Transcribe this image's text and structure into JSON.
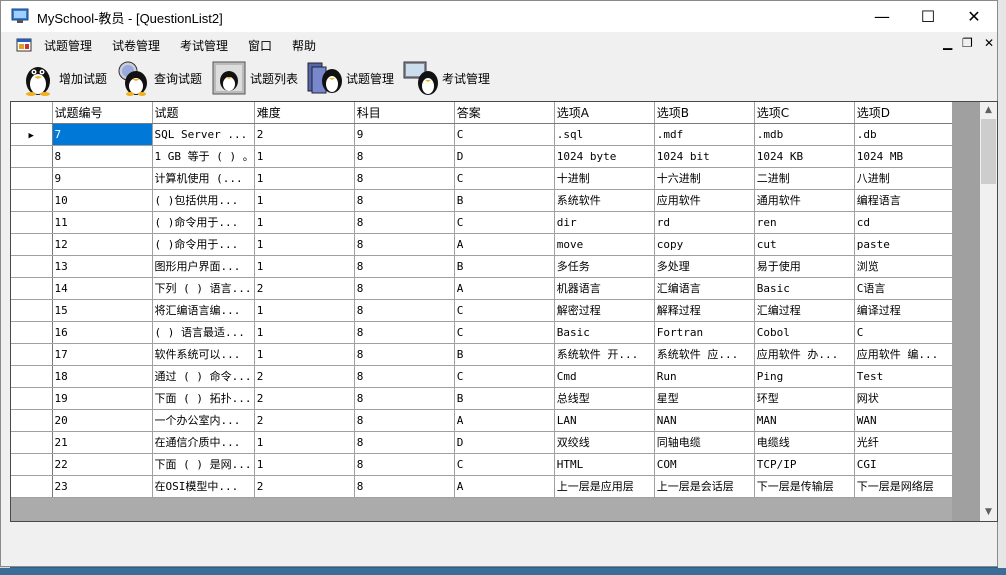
{
  "window": {
    "title": "MySchool-教员 - [QuestionList2]"
  },
  "controls": {
    "minimize": "—",
    "maximize": "☐",
    "close": "✕"
  },
  "menu": {
    "items": [
      "试题管理",
      "试卷管理",
      "考试管理",
      "窗口",
      "帮助"
    ],
    "mdi_min": "▁",
    "mdi_restore": "❐",
    "mdi_close": "✕"
  },
  "toolbar": {
    "buttons": [
      {
        "label": "增加试题",
        "icon": "penguin-add-icon"
      },
      {
        "label": "查询试题",
        "icon": "penguin-search-icon"
      },
      {
        "label": "试题列表",
        "icon": "penguin-list-icon"
      },
      {
        "label": "试题管理",
        "icon": "penguin-manage-icon"
      },
      {
        "label": "考试管理",
        "icon": "penguin-exam-icon"
      }
    ]
  },
  "grid": {
    "columns": [
      "试题编号",
      "试题",
      "难度",
      "科目",
      "答案",
      "选项A",
      "选项B",
      "选项C",
      "选项D"
    ],
    "rows": [
      [
        "7",
        "SQL Server ...",
        "2",
        "9",
        "C",
        ".sql",
        ".mdf",
        ".mdb",
        ".db"
      ],
      [
        "8",
        "1 GB 等于 ( ) 。",
        "1",
        "8",
        "D",
        "1024 byte",
        "1024 bit",
        "1024 KB",
        "1024 MB"
      ],
      [
        "9",
        "计算机使用 (...",
        "1",
        "8",
        "C",
        "十进制",
        "十六进制",
        "二进制",
        "八进制"
      ],
      [
        "10",
        "( )包括供用...",
        "1",
        "8",
        "B",
        "系统软件",
        "应用软件",
        "通用软件",
        "编程语言"
      ],
      [
        "11",
        "( )命令用于...",
        "1",
        "8",
        "C",
        "dir",
        "rd",
        "ren",
        "cd"
      ],
      [
        "12",
        "( )命令用于...",
        "1",
        "8",
        "A",
        "move",
        "copy",
        "cut",
        "paste"
      ],
      [
        "13",
        "图形用户界面...",
        "1",
        "8",
        "B",
        "多任务",
        "多处理",
        "易于使用",
        "浏览"
      ],
      [
        "14",
        "下列 ( ) 语言...",
        "2",
        "8",
        "A",
        "机器语言",
        "汇编语言",
        "Basic",
        "C语言"
      ],
      [
        "15",
        "将汇编语言编...",
        "1",
        "8",
        "C",
        "解密过程",
        "解释过程",
        "汇编过程",
        "编译过程"
      ],
      [
        "16",
        " ( ) 语言最适...",
        "1",
        "8",
        "C",
        "Basic",
        "Fortran",
        "Cobol",
        "C"
      ],
      [
        "17",
        "软件系统可以...",
        "1",
        "8",
        "B",
        "系统软件  开...",
        "系统软件  应...",
        "应用软件  办...",
        "应用软件  编..."
      ],
      [
        "18",
        "通过 ( ) 命令...",
        "2",
        "8",
        "C",
        "Cmd",
        "Run",
        "Ping",
        "Test"
      ],
      [
        "19",
        "下面 ( ) 拓扑...",
        "2",
        "8",
        "B",
        "总线型",
        "星型",
        "环型",
        "网状"
      ],
      [
        "20",
        "一个办公室内...",
        "2",
        "8",
        "A",
        "LAN",
        "NAN",
        "MAN",
        "WAN"
      ],
      [
        "21",
        "在通信介质中...",
        "1",
        "8",
        "D",
        "双绞线",
        "同轴电缆",
        "电缆线",
        "光纤"
      ],
      [
        "22",
        "下面 ( ) 是网...",
        "1",
        "8",
        "C",
        "HTML",
        "COM",
        "TCP/IP",
        "CGI"
      ],
      [
        "23",
        "在OSI模型中...",
        "2",
        "8",
        "A",
        "上一层是应用层",
        "上一层是会话层",
        "下一层是传输层",
        "下一层是网络层"
      ]
    ]
  }
}
